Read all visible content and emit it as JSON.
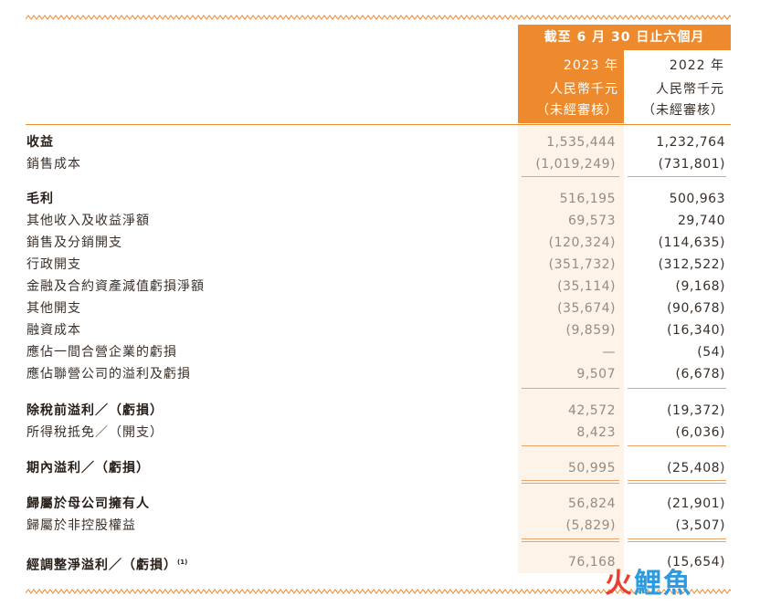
{
  "header": {
    "period": "截至 6 月 30 日止六個月",
    "col2023": {
      "year": "2023 年",
      "currency": "人民幣千元",
      "note": "（未經審核）"
    },
    "col2022": {
      "year": "2022 年",
      "currency": "人民幣千元",
      "note": "（未經審核）"
    }
  },
  "rows": [
    {
      "label": "收益",
      "bold": true,
      "v2023": "1,535,444",
      "v2022": "1,232,764"
    },
    {
      "label": "銷售成本",
      "bold": false,
      "v2023": "(1,019,249)",
      "v2022": "(731,801)"
    },
    {
      "label": "毛利",
      "bold": true,
      "v2023": "516,195",
      "v2022": "500,963"
    },
    {
      "label": "其他收入及收益淨額",
      "bold": false,
      "v2023": "69,573",
      "v2022": "29,740"
    },
    {
      "label": "銷售及分銷開支",
      "bold": false,
      "v2023": "(120,324)",
      "v2022": "(114,635)"
    },
    {
      "label": "行政開支",
      "bold": false,
      "v2023": "(351,732)",
      "v2022": "(312,522)"
    },
    {
      "label": "金融及合約資產減值虧損淨額",
      "bold": false,
      "v2023": "(35,114)",
      "v2022": "(9,168)"
    },
    {
      "label": "其他開支",
      "bold": false,
      "v2023": "(35,674)",
      "v2022": "(90,678)"
    },
    {
      "label": "融資成本",
      "bold": false,
      "v2023": "(9,859)",
      "v2022": "(16,340)"
    },
    {
      "label": "應佔一間合營企業的虧損",
      "bold": false,
      "v2023": "—",
      "v2022": "(54)"
    },
    {
      "label": "應佔聯營公司的溢利及虧損",
      "bold": false,
      "v2023": "9,507",
      "v2022": "(6,678)"
    },
    {
      "label": "除稅前溢利／（虧損）",
      "bold": true,
      "v2023": "42,572",
      "v2022": "(19,372)"
    },
    {
      "label": "所得稅抵免／（開支）",
      "bold": false,
      "v2023": "8,423",
      "v2022": "(6,036)"
    },
    {
      "label": "期內溢利／（虧損）",
      "bold": true,
      "v2023": "50,995",
      "v2022": "(25,408)"
    },
    {
      "label": "歸屬於母公司擁有人",
      "bold": true,
      "v2023": "56,824",
      "v2022": "(21,901)"
    },
    {
      "label": "歸屬於非控股權益",
      "bold": false,
      "v2023": "(5,829)",
      "v2022": "(3,507)"
    },
    {
      "label": "經調整淨溢利／（虧損）",
      "footnote": "(1)",
      "bold": true,
      "v2023": "76,168",
      "v2022": "(15,654)"
    }
  ],
  "watermark": {
    "part1": "火",
    "part2": "鯉魚"
  },
  "colors": {
    "accent": "#ee8a2e",
    "highlight": "#fdf3e8",
    "text": "#3a2f28"
  }
}
